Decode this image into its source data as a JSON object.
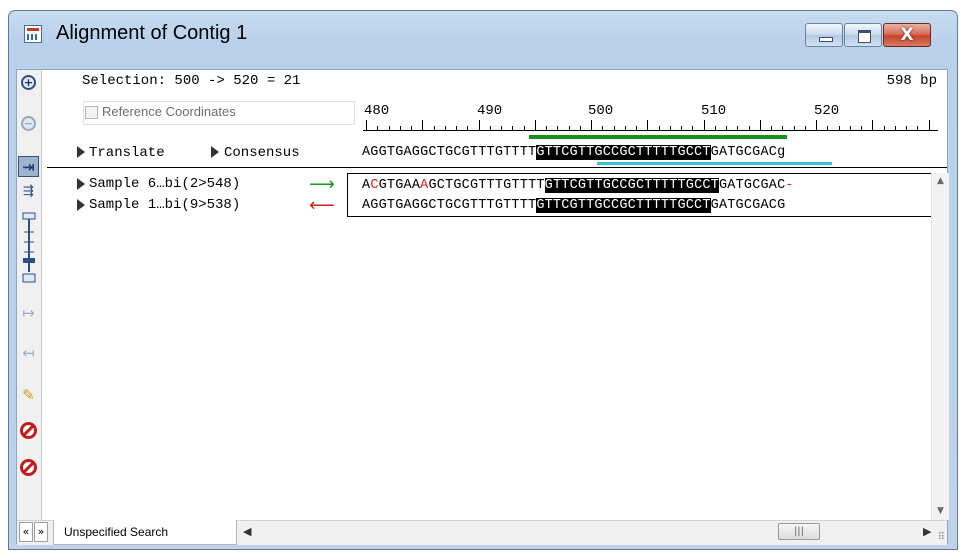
{
  "window": {
    "title": "Alignment of Contig 1",
    "close_glyph": "X"
  },
  "header": {
    "selection": "Selection: 500 -> 520 = 21",
    "length": "598 bp",
    "reference_coordinates_label": "Reference Coordinates",
    "reference_coordinates_checked": false
  },
  "ruler": {
    "labels": [
      "480",
      "490",
      "500",
      "510",
      "520"
    ]
  },
  "rows": {
    "translate_label": "Translate",
    "consensus_label": "Consensus",
    "consensus_seq": {
      "pre": "AGGTGAGGCTGCGTTTGTTTT",
      "sel": "GTTCGTTGCCGCTTTTTGCCT",
      "post": "GATGCGACg"
    },
    "samples": [
      {
        "name": "Sample 6…bi(2>548)",
        "direction": "forward",
        "seq": {
          "a": "A",
          "b": "C",
          "c": "GTGAA",
          "d": "A",
          "e": "GCTGCGTTTGTTTT",
          "sel": "GTTCGTTGCCGCTTTTTGCCT",
          "post": "GATGCGAC",
          "end": "-"
        }
      },
      {
        "name": "Sample 1…bi(9>538)",
        "direction": "reverse",
        "seq": {
          "pre": "AGGTGAGGCTGCGTTTGTTTT",
          "sel": "GTTCGTTGCCGCTTTTTGCCT",
          "post": "GATGCGACG"
        }
      }
    ]
  },
  "colors": {
    "selection_bar": "#1a8f1a",
    "consensus_underline": "#36c3d6",
    "mismatch": "#e02020"
  },
  "toolbar": {
    "tools": [
      "zoom-in-icon",
      "zoom-out-icon",
      "fit-width-icon",
      "expand-icon",
      "slider-icon",
      "shift-right-icon",
      "shift-left-icon",
      "edit-icon",
      "no-entry-icon",
      "no-entry-alt-icon"
    ]
  },
  "bottom": {
    "nav_prev": "«",
    "nav_next": "»",
    "search_tab_label": "Unspecified Search",
    "scroll_left": "◀",
    "scroll_right": "▶",
    "thumb_grip": "|||",
    "resize_grip": "⠿"
  }
}
